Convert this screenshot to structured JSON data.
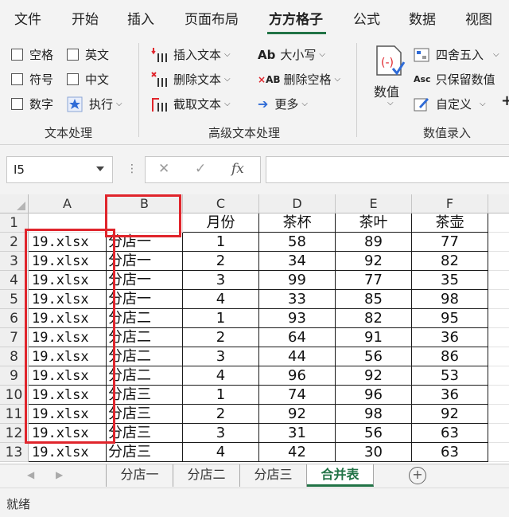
{
  "ribbon_tabs": [
    "文件",
    "开始",
    "插入",
    "页面布局",
    "方方格子",
    "公式",
    "数据",
    "视图"
  ],
  "active_tab": "方方格子",
  "text_group": {
    "checkboxes": [
      "空格",
      "英文",
      "符号",
      "中文",
      "数字"
    ],
    "execute": "执行",
    "label": "文本处理"
  },
  "advanced_group": {
    "insert_text": "插入文本",
    "delete_text": "删除文本",
    "extract_text": "截取文本",
    "case": "大小写",
    "delete_space": "删除空格",
    "more": "更多",
    "label": "高级文本处理"
  },
  "number_group": {
    "big_button": "数值",
    "round": "四舍五入",
    "keep_values": "只保留数值",
    "custom": "自定义",
    "label": "数值录入"
  },
  "formula_bar": {
    "name_box": "I5",
    "fx": "fx"
  },
  "columns": [
    "A",
    "B",
    "C",
    "D",
    "E",
    "F"
  ],
  "header_row": {
    "month": "月份",
    "cup": "茶杯",
    "tea": "茶叶",
    "pot": "茶壶"
  },
  "rows": [
    {
      "n": "1"
    },
    {
      "n": "2",
      "a": "19.xlsx",
      "b": "分店一",
      "c": "1",
      "d": "58",
      "e": "89",
      "f": "77"
    },
    {
      "n": "3",
      "a": "19.xlsx",
      "b": "分店一",
      "c": "2",
      "d": "34",
      "e": "92",
      "f": "82"
    },
    {
      "n": "4",
      "a": "19.xlsx",
      "b": "分店一",
      "c": "3",
      "d": "99",
      "e": "77",
      "f": "35"
    },
    {
      "n": "5",
      "a": "19.xlsx",
      "b": "分店一",
      "c": "4",
      "d": "33",
      "e": "85",
      "f": "98"
    },
    {
      "n": "6",
      "a": "19.xlsx",
      "b": "分店二",
      "c": "1",
      "d": "93",
      "e": "82",
      "f": "95"
    },
    {
      "n": "7",
      "a": "19.xlsx",
      "b": "分店二",
      "c": "2",
      "d": "64",
      "e": "91",
      "f": "36"
    },
    {
      "n": "8",
      "a": "19.xlsx",
      "b": "分店二",
      "c": "3",
      "d": "44",
      "e": "56",
      "f": "86"
    },
    {
      "n": "9",
      "a": "19.xlsx",
      "b": "分店二",
      "c": "4",
      "d": "96",
      "e": "92",
      "f": "53"
    },
    {
      "n": "10",
      "a": "19.xlsx",
      "b": "分店三",
      "c": "1",
      "d": "74",
      "e": "96",
      "f": "36"
    },
    {
      "n": "11",
      "a": "19.xlsx",
      "b": "分店三",
      "c": "2",
      "d": "92",
      "e": "98",
      "f": "92"
    },
    {
      "n": "12",
      "a": "19.xlsx",
      "b": "分店三",
      "c": "3",
      "d": "31",
      "e": "56",
      "f": "63"
    },
    {
      "n": "13",
      "a": "19.xlsx",
      "b": "分店三",
      "c": "4",
      "d": "42",
      "e": "30",
      "f": "63"
    }
  ],
  "sheet_tabs": [
    "分店一",
    "分店二",
    "分店三",
    "合并表"
  ],
  "active_sheet": "合并表",
  "status_text": "就绪",
  "colors": {
    "accent": "#217346",
    "highlight_red": "#e0252c"
  }
}
